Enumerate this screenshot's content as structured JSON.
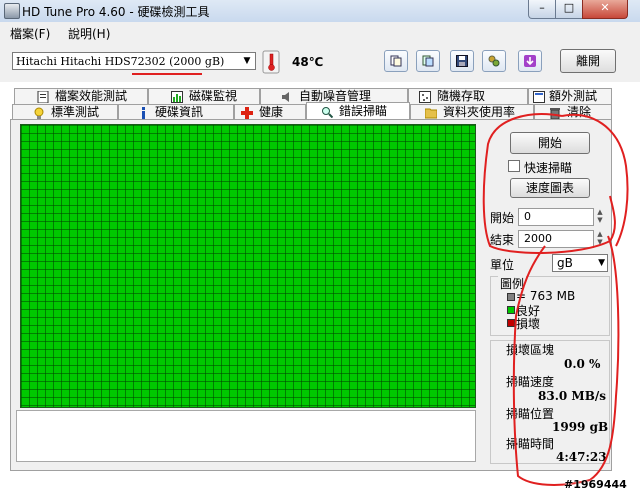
{
  "window": {
    "title": "HD Tune Pro 4.60 - 硬碟檢測工具",
    "min": "–",
    "max": "□",
    "close": "✕"
  },
  "menu": [
    {
      "label": "檔案(F)"
    },
    {
      "label": "說明(H)"
    }
  ],
  "toolbar": {
    "drive": "Hitachi Hitachi HDS72302 (2000 gB)",
    "temperature": "48℃",
    "exit_label": "離開",
    "icons": [
      "copy-text-icon",
      "copy-screen-icon",
      "save-icon",
      "options-icon",
      "download-icon"
    ]
  },
  "tabs_row1": [
    {
      "label": "檔案效能測試"
    },
    {
      "label": "磁碟監視"
    },
    {
      "label": "自動噪音管理"
    },
    {
      "label": "隨機存取"
    },
    {
      "label": "額外測試"
    }
  ],
  "tabs_row2": [
    {
      "label": "標準測試"
    },
    {
      "label": "硬碟資訊"
    },
    {
      "label": "健康"
    },
    {
      "label": "錯誤掃瞄"
    },
    {
      "label": "資料夾使用率"
    },
    {
      "label": "清除"
    }
  ],
  "active_tab": "錯誤掃瞄",
  "scan": {
    "start_button": "開始",
    "quick_scan_label": "快速掃瞄",
    "quick_scan_checked": false,
    "speed_chart_button": "速度圖表",
    "start_label": "開始",
    "start_value": "0",
    "end_label": "結束",
    "end_value": "2000",
    "unit_label": "單位",
    "unit_value": "gB"
  },
  "legend": {
    "title": "圖例",
    "items": [
      {
        "label": "= 763 MB",
        "color": "#808080"
      },
      {
        "label": "良好",
        "color": "#00c800"
      },
      {
        "label": "損壞",
        "color": "#c00000"
      }
    ]
  },
  "stats": {
    "damaged_blocks_label": "損壞區塊",
    "damaged_blocks_value": "0.0 %",
    "scan_speed_label": "掃瞄速度",
    "scan_speed_value": "83.0 MB/s",
    "scan_position_label": "掃瞄位置",
    "scan_position_value": "1999 gB",
    "scan_time_label": "掃瞄時間",
    "scan_time_value": "4:47:23"
  },
  "watermark": "#1969444",
  "colors": {
    "good": "#00c800",
    "damaged": "#c00000",
    "annotation": "#e02020"
  }
}
